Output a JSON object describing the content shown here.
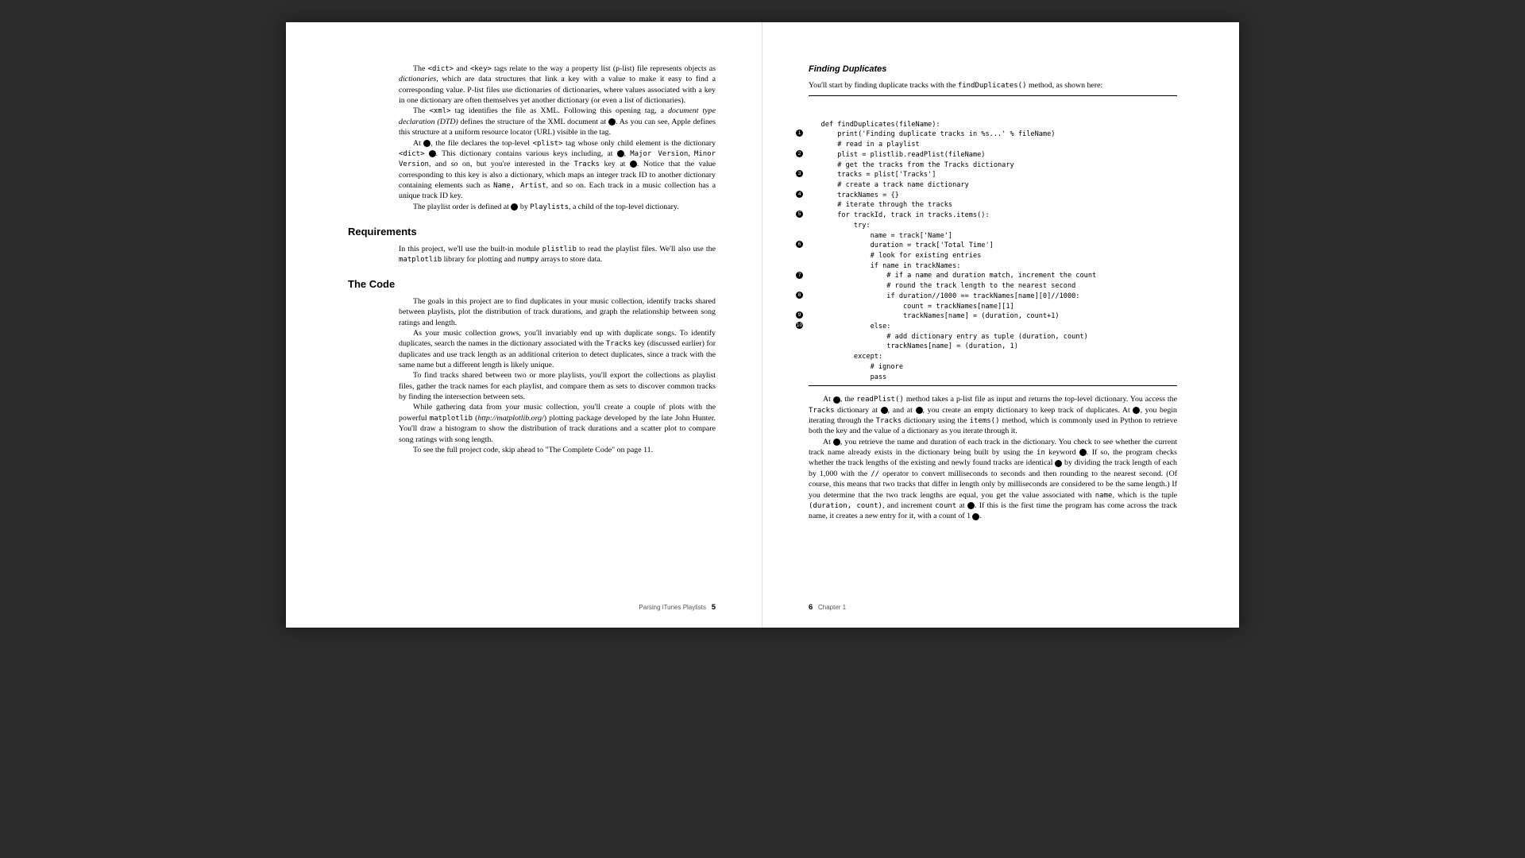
{
  "leftPage": {
    "para1a": "The ",
    "para1b": " and ",
    "para1c": " tags relate to the way a property list (p-list) file represents objects as ",
    "para1d": ", which are data structures that link a key with a value to make it easy to find a corresponding value. P-list files use dictionaries of dictionaries, where values associated with a key in one dictionary are often themselves yet another dictionary (or even a list of dictionaries).",
    "dict_tag": "<dict>",
    "key_tag": "<key>",
    "dictionaries": "dictionaries",
    "para2a": "The ",
    "para2b": " tag identifies the file as XML. Following this opening tag, a ",
    "para2c": " defines the structure of the XML document at ",
    "para2d": ". As you can see, Apple defines this structure at a uniform resource locator (URL) visible in the tag.",
    "xml_tag": "<xml>",
    "dtd": "document type declaration (DTD)",
    "para3a": "At ",
    "para3b": ", the file declares the top-level ",
    "para3c": " tag whose only child element is the dictionary ",
    "para3d": ". This dictionary contains various keys including, at ",
    "para3e": ", ",
    "para3f": ", and so on, but you're interested in the ",
    "para3g": " key at ",
    "para3h": ". Notice that the value corresponding to this key is also a dictionary, which maps an integer track ID to another dictionary containing elements such as ",
    "para3i": ", and so on. Each track in a music collection has a unique track ID key.",
    "plist_tag": "<plist>",
    "dict_tag2": "<dict>",
    "majorv": "Major Version",
    "minorv": "Minor Version",
    "tracks": "Tracks",
    "name_artist": "Name, Artist",
    "para4a": "The playlist order is defined at ",
    "para4b": " by ",
    "para4c": ", a child of the top-level dictionary.",
    "playlists": "Playlists",
    "h_req": "Requirements",
    "req_a": "In this project, we'll use the built-in module ",
    "req_b": " to read the playlist files. We'll also use the ",
    "req_c": " library for plotting and ",
    "req_d": " arrays to store data.",
    "plistlib": "plistlib",
    "matplotlib": "matplotlib",
    "numpy": "numpy",
    "h_code": "The Code",
    "code_p1": "The goals in this project are to find duplicates in your music collection, identify tracks shared between playlists, plot the distribution of track durations, and graph the relationship between song ratings and length.",
    "code_p2a": "As your music collection grows, you'll invariably end up with duplicate songs. To identify duplicates, search the names in the dictionary associated with the ",
    "code_p2b": " key (discussed earlier) for duplicates and use track length as an additional criterion to detect duplicates, since a track with the same name but a different length is likely unique.",
    "code_p3": "To find tracks shared between two or more playlists, you'll export the collections as playlist files, gather the track names for each playlist, and compare them as sets to discover common tracks by finding the intersection between sets.",
    "code_p4a": "While gathering data from your music collection, you'll create a couple of plots with the powerful ",
    "code_p4b": " (",
    "code_p4c": ") plotting package developed by the late John Hunter. You'll draw a histogram to show the distribution of track durations and a scatter plot to compare song ratings with song length.",
    "mpl_url": "http://matplotlib.org/",
    "code_p5": "To see the full project code, skip ahead to \"The Complete Code\" on page 11.",
    "footer_label": "Parsing iTunes Playlists",
    "footer_num": "5"
  },
  "rightPage": {
    "h_find": "Finding Duplicates",
    "intro_a": "You'll start by finding duplicate tracks with the ",
    "intro_b": " method, as shown here:",
    "findDup": "findDuplicates()",
    "code": "   def findDuplicates(fileName):\n       print('Finding duplicate tracks in %s...' % fileName)\n       # read in a playlist\n       plist = plistlib.readPlist(fileName)\n       # get the tracks from the Tracks dictionary\n       tracks = plist['Tracks']\n       # create a track name dictionary\n       trackNames = {}\n       # iterate through the tracks\n       for trackId, track in tracks.items():\n           try:\n               name = track['Name']\n               duration = track['Total Time']\n               # look for existing entries\n               if name in trackNames:\n                   # if a name and duration match, increment the count\n                   # round the track length to the nearest second\n                   if duration//1000 == trackNames[name][0]//1000:\n                       count = trackNames[name][1]\n                       trackNames[name] = (duration, count+1)\n               else:\n                   # add dictionary entry as tuple (duration, count)\n                   trackNames[name] = (duration, 1)\n           except:\n               # ignore\n               pass",
    "callouts": [
      {
        "n": "1",
        "line": 3
      },
      {
        "n": "2",
        "line": 5
      },
      {
        "n": "3",
        "line": 7
      },
      {
        "n": "4",
        "line": 9
      },
      {
        "n": "5",
        "line": 11
      },
      {
        "n": "6",
        "line": 14
      },
      {
        "n": "7",
        "line": 17
      },
      {
        "n": "8",
        "line": 19
      },
      {
        "n": "9",
        "line": 21
      },
      {
        "n": "10",
        "line": 22
      }
    ],
    "exp1a": "At ",
    "exp1b": ", the ",
    "exp1c": " method takes a p-list file as input and returns the top-level dictionary. You access the ",
    "exp1d": " dictionary at ",
    "exp1e": ", and at ",
    "exp1f": ", you create an empty dictionary to keep track of duplicates. At ",
    "exp1g": ", you begin iterating through the ",
    "exp1h": " dictionary using the ",
    "exp1i": " method, which is commonly used in Python to retrieve both the key and the value of a dictionary as you iterate through it.",
    "readPlist": "readPlist()",
    "items": "items()",
    "exp2a": "At ",
    "exp2b": ", you retrieve the name and duration of each track in the dictionary. You check to see whether the current track name already exists in the dictionary being built by using the ",
    "exp2c": " keyword ",
    "exp2d": ". If so, the program checks whether the track lengths of the existing and newly found tracks are identical ",
    "exp2e": " by dividing the track length of each by 1,000 with the ",
    "exp2f": " operator to convert milliseconds to seconds and then rounding to the nearest second. (Of course, this means that two tracks that differ in length only by milliseconds are considered to be the same length.) If you determine that the two track lengths are equal, you get the value associated with ",
    "exp2g": ", which is the tuple ",
    "exp2h": ", and increment ",
    "exp2i": " at ",
    "exp2j": ". If this is the first time the program has come across the track name, it creates a new entry for it, with a count of 1 ",
    "exp2k": ".",
    "in_kw": "in",
    "slashslash": "//",
    "name_kw": "name",
    "tuple": "(duration, count)",
    "count_kw": "count",
    "footer_num": "6",
    "footer_label": "Chapter 1"
  }
}
